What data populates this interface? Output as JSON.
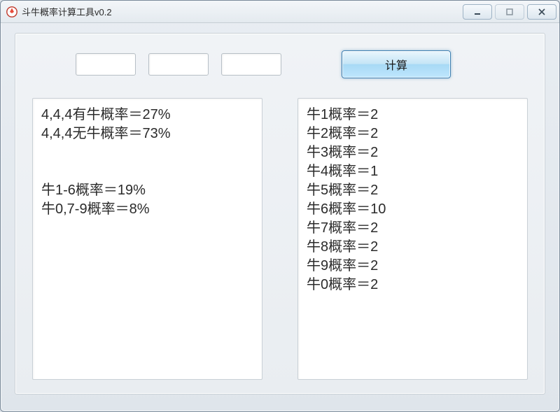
{
  "window": {
    "title": "斗牛概率计算工具v0.2"
  },
  "inputs": {
    "card1": "",
    "card2": "",
    "card3": ""
  },
  "buttons": {
    "calculate": "计算"
  },
  "results": {
    "left": "4,4,4有牛概率＝27%\n4,4,4无牛概率＝73%\n\n\n牛1-6概率＝19%\n牛0,7-9概率＝8%",
    "right": "牛1概率＝2\n牛2概率＝2\n牛3概率＝2\n牛4概率＝1\n牛5概率＝2\n牛6概率＝10\n牛7概率＝2\n牛8概率＝2\n牛9概率＝2\n牛0概率＝2"
  }
}
